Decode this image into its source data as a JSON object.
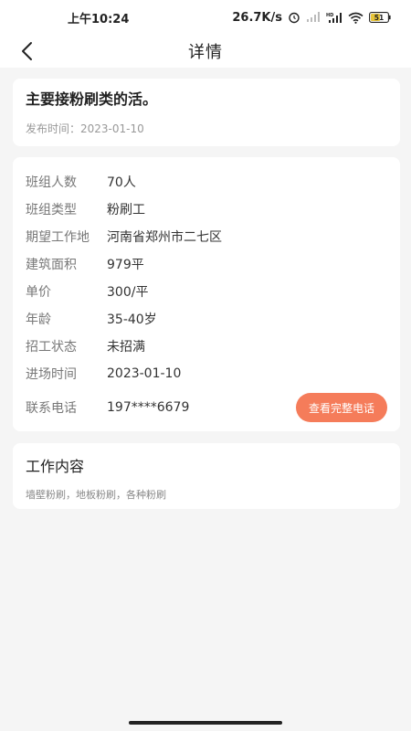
{
  "status_bar": {
    "time": "上午10:24",
    "network_speed": "26.7K/s",
    "battery": "51"
  },
  "nav": {
    "title": "详情",
    "back_icon": "chevron-left-icon"
  },
  "job": {
    "title": "主要接粉刷类的活。",
    "publish_label": "发布时间：",
    "publish_date": "2023-01-10"
  },
  "info": {
    "rows": [
      {
        "label": "班组人数",
        "value": "70人"
      },
      {
        "label": "班组类型",
        "value": "粉刷工"
      },
      {
        "label": "期望工作地",
        "value": "河南省郑州市二七区"
      },
      {
        "label": "建筑面积",
        "value": "979平"
      },
      {
        "label": "单价",
        "value": "300/平"
      },
      {
        "label": "年龄",
        "value": "35-40岁"
      },
      {
        "label": "招工状态",
        "value": "未招满"
      },
      {
        "label": "进场时间",
        "value": "2023-01-10"
      }
    ],
    "phone_label": "联系电话",
    "phone_value": "197****6679",
    "phone_button": "查看完整电话"
  },
  "work": {
    "heading": "工作内容",
    "content": "墙壁粉刷，地板粉刷，各种粉刷"
  },
  "colors": {
    "accent": "#f57c5a",
    "background": "#f5f5f5"
  }
}
